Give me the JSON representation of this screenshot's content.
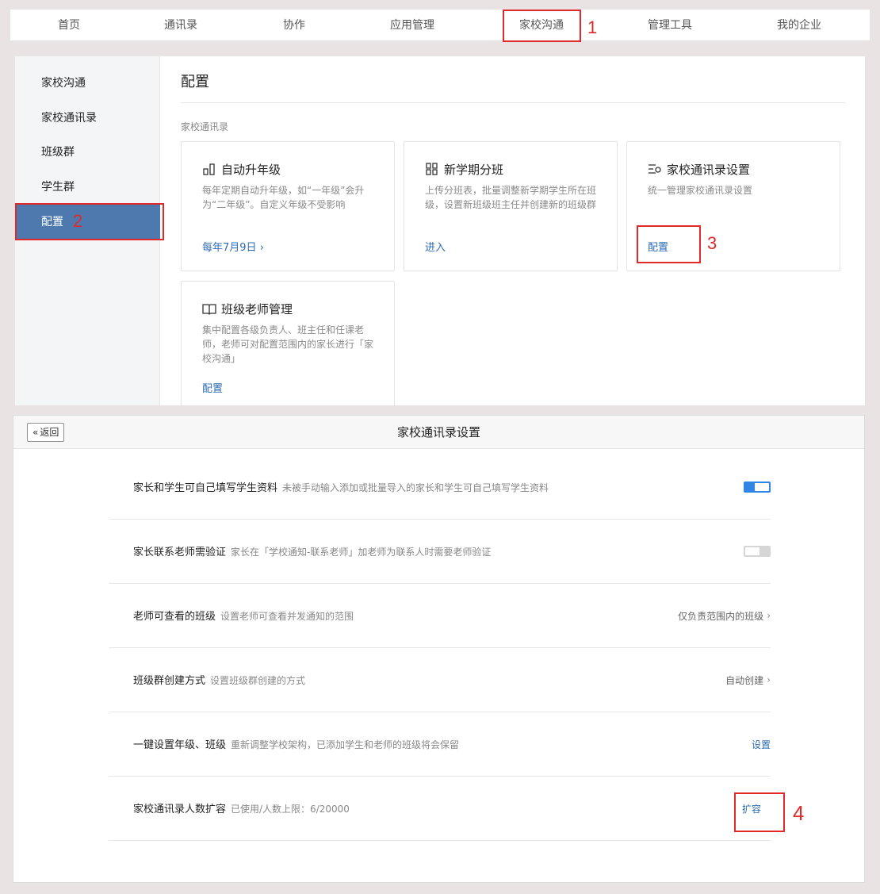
{
  "topnav": {
    "tabs": [
      {
        "label": "首页"
      },
      {
        "label": "通讯录"
      },
      {
        "label": "协作"
      },
      {
        "label": "应用管理"
      },
      {
        "label": "家校沟通"
      },
      {
        "label": "管理工具"
      },
      {
        "label": "我的企业"
      }
    ]
  },
  "sidebar": {
    "items": [
      {
        "label": "家校沟通"
      },
      {
        "label": "家校通讯录"
      },
      {
        "label": "班级群"
      },
      {
        "label": "学生群"
      },
      {
        "label": "配置"
      }
    ]
  },
  "content": {
    "title": "配置",
    "section_label": "家校通讯录",
    "cards": [
      {
        "icon": "bar-chart-icon",
        "title": "自动升年级",
        "desc": "每年定期自动升年级，如“一年级”会升为“二年级”。自定义年级不受影响",
        "link": "每年7月9日",
        "link_arrow": "›"
      },
      {
        "icon": "grid-icon",
        "title": "新学期分班",
        "desc": "上传分班表，批量调整新学期学生所在班级，设置新班级班主任并创建新的班级群",
        "link": "进入"
      },
      {
        "icon": "list-settings-icon",
        "title": "家校通讯录设置",
        "desc": "统一管理家校通讯录设置",
        "link": "配置"
      },
      {
        "icon": "book-icon",
        "title": "班级老师管理",
        "desc": "集中配置各级负责人、班主任和任课老师，老师可对配置范围内的家长进行「家校沟通」",
        "link": "配置"
      }
    ]
  },
  "settings": {
    "back_label": "返回",
    "back_icon": "double-chevron-left-icon",
    "title": "家校通讯录设置",
    "rows": [
      {
        "name": "家长和学生可自己填写学生资料",
        "desc": "未被手动输入添加或批量导入的家长和学生可自己填写学生资料",
        "control": "toggle",
        "on": true
      },
      {
        "name": "家长联系老师需验证",
        "desc": "家长在「学校通知-联系老师」加老师为联系人时需要老师验证",
        "control": "toggle",
        "on": false
      },
      {
        "name": "老师可查看的班级",
        "desc": "设置老师可查看并发通知的范围",
        "control": "select",
        "value": "仅负责范围内的班级",
        "arrow": "›"
      },
      {
        "name": "班级群创建方式",
        "desc": "设置班级群创建的方式",
        "control": "select",
        "value": "自动创建",
        "arrow": "›"
      },
      {
        "name": "一键设置年级、班级",
        "desc": "重新调整学校架构，已添加学生和老师的班级将会保留",
        "control": "link",
        "value": "设置"
      },
      {
        "name": "家校通讯录人数扩容",
        "desc": "已使用/人数上限：6/20000",
        "control": "link",
        "value": "扩容"
      }
    ]
  },
  "annotations": [
    "1",
    "2",
    "3",
    "4"
  ],
  "colors": {
    "accent": "#4d79ae",
    "link": "#2d6cb3",
    "toggle_on": "#2f86e5",
    "annotation": "#e02a2a"
  }
}
